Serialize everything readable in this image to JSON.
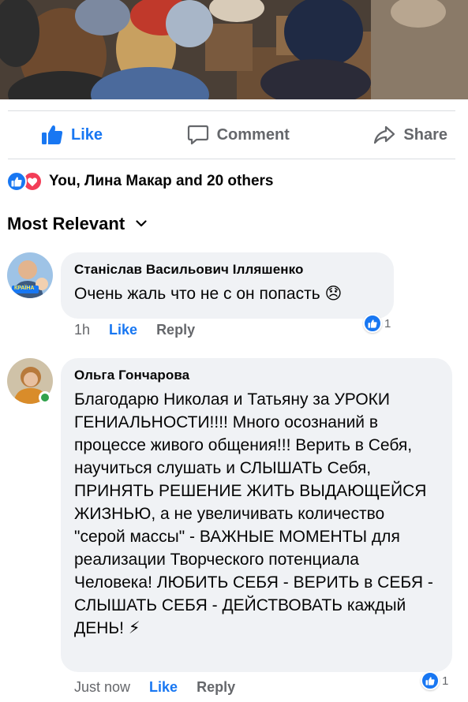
{
  "actions": {
    "like_label": "Like",
    "comment_label": "Comment",
    "share_label": "Share"
  },
  "reactions_summary": {
    "icons": [
      "like-reaction-icon",
      "love-reaction-icon"
    ],
    "text": "You, Лина Макар and 20 others"
  },
  "sort": {
    "label": "Most Relevant",
    "icon": "chevron-down-icon"
  },
  "comments": [
    {
      "author": "Станіслав Васильович Ілляшенко",
      "text": "Очень жаль что не с он попасть 😞",
      "time": "1h",
      "like_label": "Like",
      "reply_label": "Reply",
      "reaction_count": "1",
      "avatar_badge": "КРАЇНА"
    },
    {
      "author": "Ольга Гончарова",
      "text": "Благодарю Николая и Татьяну за УРОКИ ГЕНИАЛЬНОСТИ!!!! Много осознаний  в процессе живого общения!!! Верить в Себя, научиться слушать и СЛЫШАТЬ Себя, ПРИНЯТЬ РЕШЕНИЕ ЖИТЬ ВЫДАЮЩЕЙСЯ ЖИЗНЬЮ, а не увеличивать количество \"серой массы\" - ВАЖНЫЕ МОМЕНТЫ для реализации Творческого потенциала Человека! ЛЮБИТЬ СЕБЯ - ВЕРИТЬ в СЕБЯ - СЛЫШАТЬ СЕБЯ - ДЕЙСТВОВАТЬ каждый ДЕНЬ! ⚡",
      "time": "Just now",
      "like_label": "Like",
      "reply_label": "Reply",
      "reaction_count": "1",
      "online": true
    }
  ],
  "colors": {
    "accent": "#1877f2",
    "secondary_text": "#65676b",
    "bubble": "#f0f2f5",
    "love": "#f33e58",
    "online": "#31a24c"
  }
}
